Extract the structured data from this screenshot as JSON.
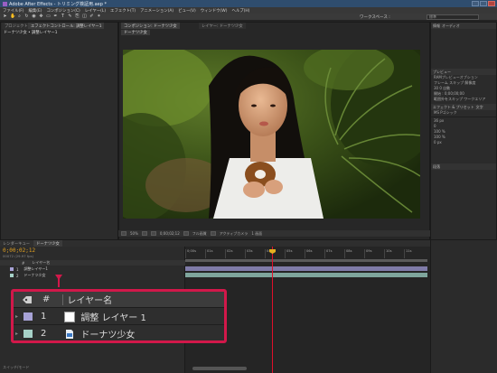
{
  "app": {
    "window_title": "Adobe After Effects - トリミング検証用.aep *",
    "menu": [
      "ファイル(F)",
      "編集(E)",
      "コンポジション(C)",
      "レイヤー(L)",
      "エフェクト(T)",
      "アニメーション(A)",
      "ビュー(V)",
      "ウィンドウ(W)",
      "ヘルプ(H)"
    ],
    "workspace_label": "ワークスペース :",
    "workspace_value": "標準",
    "toolbar_icons": [
      "selection-tool-icon",
      "hand-tool-icon",
      "zoom-tool-icon",
      "rotate-tool-icon",
      "camera-tool-icon",
      "pan-behind-tool-icon",
      "rectangle-tool-icon",
      "pen-tool-icon",
      "text-tool-icon",
      "brush-tool-icon",
      "clone-tool-icon",
      "eraser-tool-icon",
      "roto-brush-tool-icon",
      "puppet-tool-icon"
    ]
  },
  "project_panel": {
    "tab": "プロジェクト",
    "tab2": "エフェクトコントロール: 調整レイヤー1",
    "subtitle": "ドーナツ少女 • 調整レイヤー1"
  },
  "comp_panel": {
    "tab": "コンポジション: ドーナツ少女",
    "tab2": "レイヤー: ドーナツ少女",
    "subtab": "ドーナツ少女",
    "zoom": "50%",
    "timecode": "0;00;02;12",
    "resolution": "フル画質",
    "view": "アクティブカメラ",
    "views": "1 画面"
  },
  "right_panel": {
    "info_tab": "情報",
    "audio_tab": "オーディオ",
    "preview_tab": "プレビュー",
    "preview_rows": [
      "RAMプレビューオプション",
      "フレーム  スキップ  解像度",
      "30       0       自動",
      "開始 : 0;00;00;00",
      "範囲外をスキップ  ワークエリア"
    ],
    "effects_tab": "エフェクト & プリセット",
    "character_tab": "文字",
    "paragraph_tab": "段落",
    "font": "MS Pゴシック",
    "size": "36 px",
    "tracking": "0",
    "scale_v": "100 %",
    "scale_h": "100 %",
    "baseline": "0 px"
  },
  "timeline": {
    "tabs": [
      "レンダーキュー",
      "ドーナツ少女"
    ],
    "timecode": "0;00;02;12",
    "frames": "00072 (29.97 fps)",
    "columns": [
      "#",
      "レイヤー名"
    ],
    "ruler": [
      "0;00s",
      "01s",
      "02s",
      "03s",
      "04s",
      "05s",
      "06s",
      "07s",
      "08s",
      "09s",
      "10s",
      "11s"
    ],
    "layers": [
      {
        "index": "1",
        "name": "調整レイヤー1",
        "color": "#a7a2d6"
      },
      {
        "index": "2",
        "name": "ドーナツ少女",
        "color": "#a6d2c8"
      }
    ],
    "footer": "スイッチ/モード"
  },
  "callout": {
    "label_icon": "label-tag-icon",
    "col_number": "#",
    "col_name": "レイヤー名",
    "rows": [
      {
        "index": "1",
        "name": "調整 レイヤー 1",
        "color": "#a7a2d6",
        "icon": "solid-white-icon"
      },
      {
        "index": "2",
        "name": "ドーナツ少女",
        "color": "#a6d2c8",
        "icon": "footage-file-icon"
      }
    ]
  },
  "colors": {
    "accent": "#d2184a",
    "timecode": "#e0a020",
    "cti": "#e0102a"
  }
}
